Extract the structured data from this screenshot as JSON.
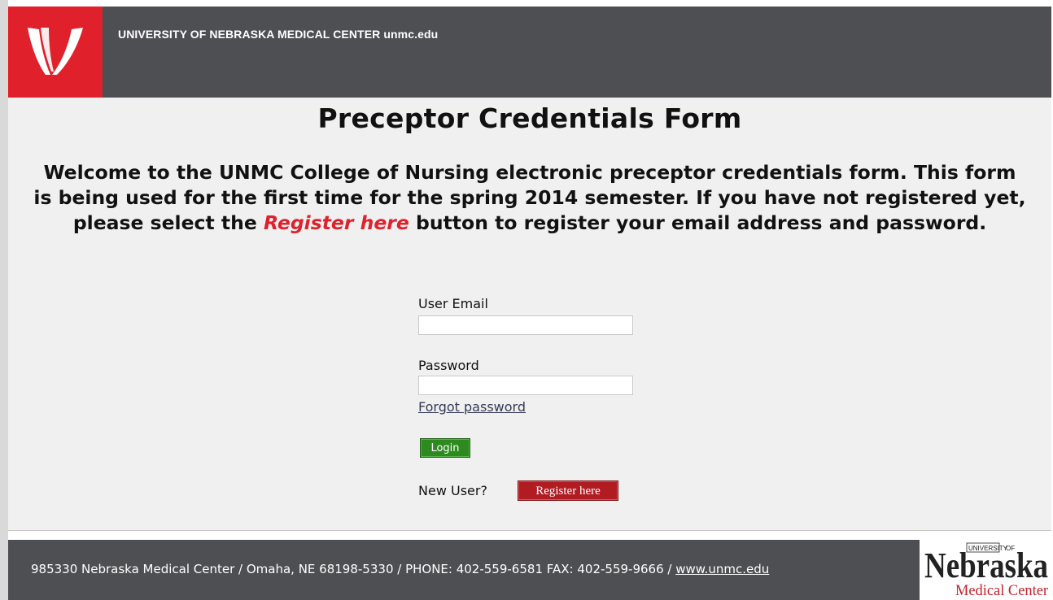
{
  "header": {
    "title": "UNIVERSITY OF NEBRASKA MEDICAL CENTER unmc.edu",
    "logo_icon": "unmc-logo-icon",
    "logo_color": "#e0202a",
    "bg_color": "#4e4f53"
  },
  "main": {
    "title": "Preceptor Credentials Form",
    "welcome_before": "Welcome to the UNMC College of Nursing electronic preceptor credentials form. This form is being used for the first time for the spring 2014 semester. If you have not registered yet, please select the ",
    "welcome_link": "Register here",
    "welcome_after": " button to register your email address and password."
  },
  "form": {
    "email_label": "User Email",
    "email_value": "",
    "password_label": "Password",
    "password_value": "",
    "forgot_label": "Forgot password",
    "login_label": "Login",
    "login_color": "#2d8a1e",
    "new_user_label": "New User?",
    "register_label": "Register here",
    "register_color": "#b01c22"
  },
  "footer": {
    "address": "985330 Nebraska Medical Center / Omaha, NE  68198-5330 / PHONE: 402-559-6581 FAX: 402-559-9666 / ",
    "link": "www.unmc.edu",
    "logo_line1": "Nebraska",
    "logo_small1": "UNIVERSITY",
    "logo_small2": "OF",
    "logo_line2": "Medical Center"
  }
}
